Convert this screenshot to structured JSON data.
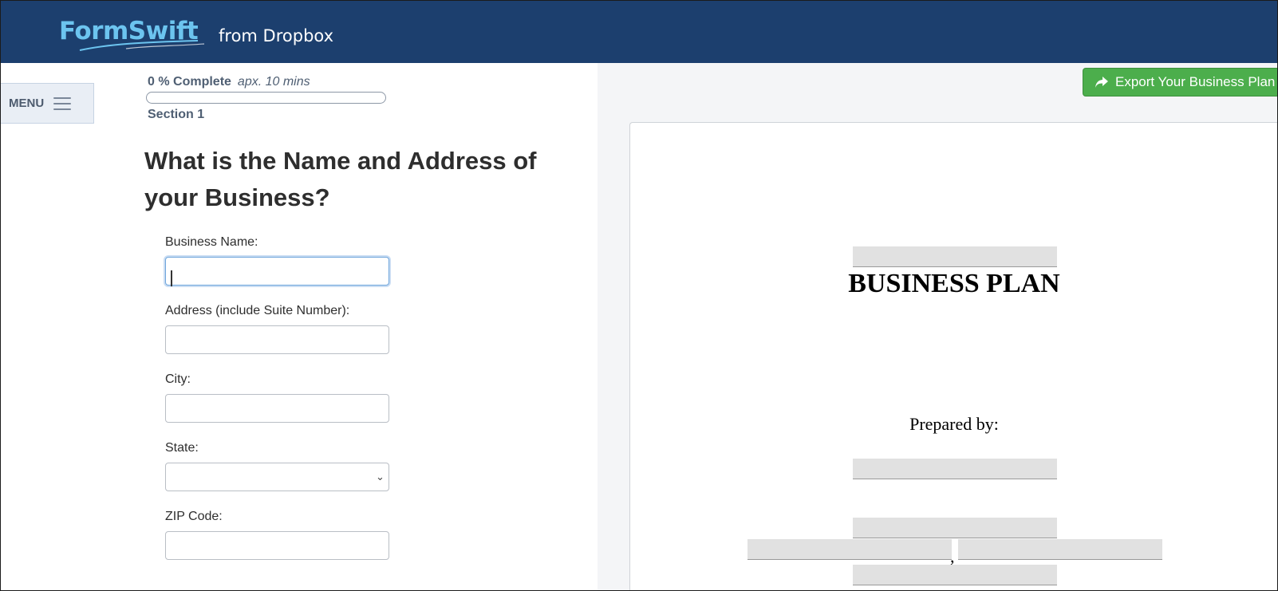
{
  "header": {
    "logo_text": "FormSwift",
    "logo_suffix": "from Dropbox",
    "background_color": "#1c3f6e",
    "accent_color": "#6cc4ef"
  },
  "menu": {
    "label": "MENU",
    "icon": "hamburger-icon"
  },
  "progress": {
    "percent_label": "0 % Complete",
    "time_estimate": "apx. 10 mins",
    "value": 0,
    "section": "Section 1"
  },
  "question": {
    "title": "What is the Name and Address of your Business?"
  },
  "form": {
    "business_name": {
      "label": "Business Name:",
      "value": ""
    },
    "address": {
      "label": "Address (include Suite Number):",
      "value": ""
    },
    "city": {
      "label": "City:",
      "value": ""
    },
    "state": {
      "label": "State:",
      "selected": ""
    },
    "zip": {
      "label": "ZIP Code:",
      "value": ""
    }
  },
  "export": {
    "label": "Export Your Business Plan",
    "icon": "share-arrow-icon",
    "color": "#4cae4c"
  },
  "document": {
    "title": "BUSINESS PLAN",
    "prepared_by": "Prepared by:",
    "separator": ","
  }
}
